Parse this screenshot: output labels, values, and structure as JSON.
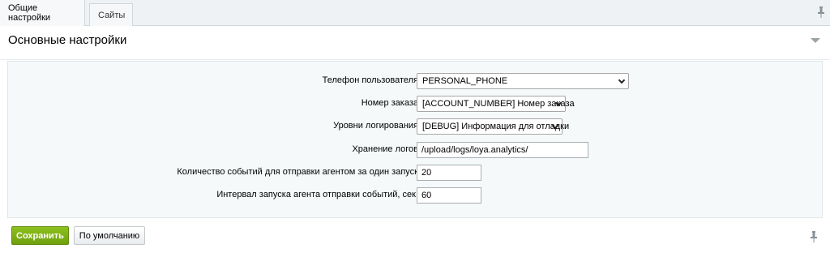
{
  "tabs": [
    {
      "label": "Общие настройки"
    },
    {
      "label": "Сайты"
    }
  ],
  "section": {
    "title": "Основные настройки"
  },
  "form": {
    "rows": [
      {
        "label": "Телефон пользователя",
        "value": "PERSONAL_PHONE"
      },
      {
        "label": "Номер заказа",
        "value": "[ACCOUNT_NUMBER] Номер заказа"
      },
      {
        "label": "Уровни логирования",
        "value": "[DEBUG] Информация для отладки"
      },
      {
        "label": "Хранение логов",
        "value": "/upload/logs/loya.analytics/"
      },
      {
        "label": "Количество событий для отправки агентом за один запуск",
        "value": "20"
      },
      {
        "label": "Интервал запуска агента отправки событий, сек.",
        "value": "60"
      }
    ]
  },
  "buttons": {
    "save_label": "Сохранить",
    "default_label": "По умолчанию"
  },
  "icons": {
    "pin": "pin-icon",
    "collapse": "collapse-triangle-icon"
  },
  "colors": {
    "accent": "#7fb115",
    "form_bg": "#f5f9f9"
  }
}
